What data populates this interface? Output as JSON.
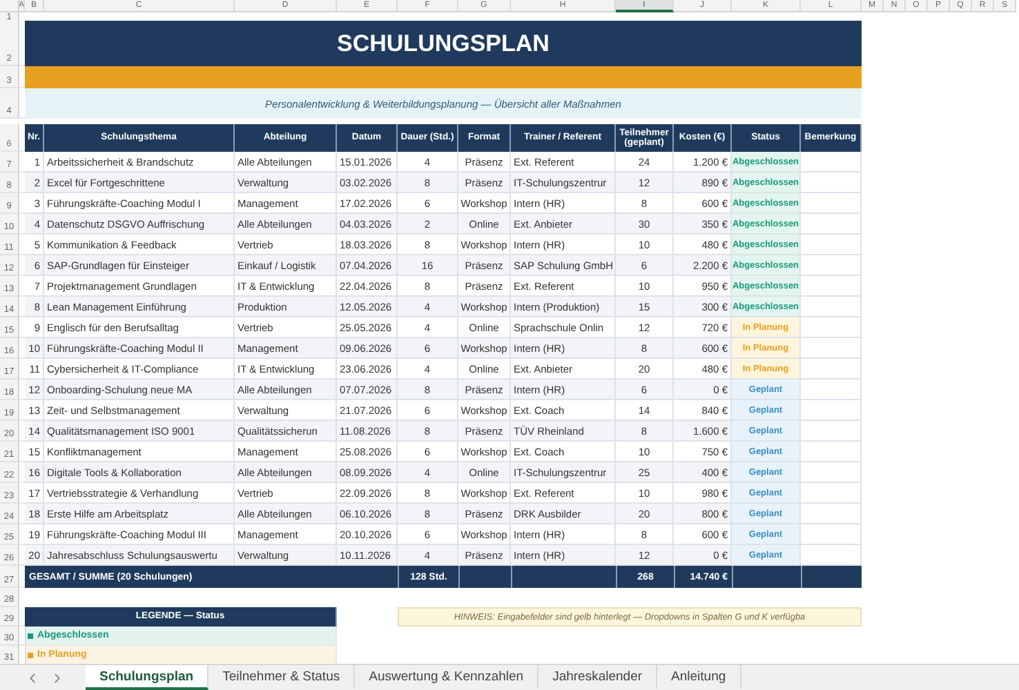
{
  "column_headers": [
    {
      "label": "A",
      "selected": false
    },
    {
      "label": "B",
      "selected": false
    },
    {
      "label": "C",
      "selected": false
    },
    {
      "label": "D",
      "selected": false
    },
    {
      "label": "E",
      "selected": false
    },
    {
      "label": "F",
      "selected": false
    },
    {
      "label": "G",
      "selected": false
    },
    {
      "label": "H",
      "selected": false
    },
    {
      "label": "I",
      "selected": true
    },
    {
      "label": "J",
      "selected": false
    },
    {
      "label": "K",
      "selected": false
    },
    {
      "label": "L",
      "selected": false
    },
    {
      "label": "M",
      "selected": false
    },
    {
      "label": "N",
      "selected": false
    },
    {
      "label": "O",
      "selected": false
    },
    {
      "label": "P",
      "selected": false
    },
    {
      "label": "Q",
      "selected": false
    },
    {
      "label": "R",
      "selected": false
    },
    {
      "label": "S",
      "selected": false
    }
  ],
  "row_headers": [
    "1",
    "2",
    "3",
    "4",
    "6",
    "7",
    "8",
    "9",
    "10",
    "11",
    "12",
    "13",
    "14",
    "15",
    "16",
    "17",
    "18",
    "19",
    "20",
    "21",
    "22",
    "23",
    "24",
    "25",
    "26",
    "27",
    "28",
    "29",
    "30",
    "31"
  ],
  "title": "SCHULUNGSPLAN",
  "subtitle": "Personalentwicklung & Weiterbildungsplanung — Übersicht aller Maßnahmen",
  "table": {
    "columns": [
      "Nr.",
      "Schulungsthema",
      "Abteilung",
      "Datum",
      "Dauer (Std.)",
      "Format",
      "Trainer / Referent",
      "Teilnehmer (geplant)",
      "Kosten (€)",
      "Status",
      "Bemerkung"
    ],
    "rows": [
      {
        "nr": "1",
        "topic": "Arbeitssicherheit & Brandschutz",
        "department": "Alle Abteilungen",
        "date": "15.01.2026",
        "duration": "4",
        "format": "Präsenz",
        "trainer": "Ext. Referent",
        "participants": "24",
        "costs": "1.200 €",
        "status": "Abgeschlossen",
        "kind": "done"
      },
      {
        "nr": "2",
        "topic": "Excel für Fortgeschrittene",
        "department": "Verwaltung",
        "date": "03.02.2026",
        "duration": "8",
        "format": "Präsenz",
        "trainer": "IT-Schulungszentrur",
        "participants": "12",
        "costs": "890 €",
        "status": "Abgeschlossen",
        "kind": "done"
      },
      {
        "nr": "3",
        "topic": "Führungskräfte-Coaching Modul I",
        "department": "Management",
        "date": "17.02.2026",
        "duration": "6",
        "format": "Workshop",
        "trainer": "Intern (HR)",
        "participants": "8",
        "costs": "600 €",
        "status": "Abgeschlossen",
        "kind": "done"
      },
      {
        "nr": "4",
        "topic": "Datenschutz DSGVO Auffrischung",
        "department": "Alle Abteilungen",
        "date": "04.03.2026",
        "duration": "2",
        "format": "Online",
        "trainer": "Ext. Anbieter",
        "participants": "30",
        "costs": "350 €",
        "status": "Abgeschlossen",
        "kind": "done"
      },
      {
        "nr": "5",
        "topic": "Kommunikation & Feedback",
        "department": "Vertrieb",
        "date": "18.03.2026",
        "duration": "8",
        "format": "Workshop",
        "trainer": "Intern (HR)",
        "participants": "10",
        "costs": "480 €",
        "status": "Abgeschlossen",
        "kind": "done"
      },
      {
        "nr": "6",
        "topic": "SAP-Grundlagen für Einsteiger",
        "department": "Einkauf / Logistik",
        "date": "07.04.2026",
        "duration": "16",
        "format": "Präsenz",
        "trainer": "SAP Schulung GmbH",
        "participants": "6",
        "costs": "2.200 €",
        "status": "Abgeschlossen",
        "kind": "done"
      },
      {
        "nr": "7",
        "topic": "Projektmanagement Grundlagen",
        "department": "IT & Entwicklung",
        "date": "22.04.2026",
        "duration": "8",
        "format": "Präsenz",
        "trainer": "Ext. Referent",
        "participants": "10",
        "costs": "950 €",
        "status": "Abgeschlossen",
        "kind": "done"
      },
      {
        "nr": "8",
        "topic": "Lean Management Einführung",
        "department": "Produktion",
        "date": "12.05.2026",
        "duration": "4",
        "format": "Workshop",
        "trainer": "Intern (Produktion)",
        "participants": "15",
        "costs": "300 €",
        "status": "Abgeschlossen",
        "kind": "done"
      },
      {
        "nr": "9",
        "topic": "Englisch für den Berufsalltag",
        "department": "Vertrieb",
        "date": "25.05.2026",
        "duration": "4",
        "format": "Online",
        "trainer": "Sprachschule Onlin",
        "participants": "12",
        "costs": "720 €",
        "status": "In Planung",
        "kind": "planning"
      },
      {
        "nr": "10",
        "topic": "Führungskräfte-Coaching Modul II",
        "department": "Management",
        "date": "09.06.2026",
        "duration": "6",
        "format": "Workshop",
        "trainer": "Intern (HR)",
        "participants": "8",
        "costs": "600 €",
        "status": "In Planung",
        "kind": "planning"
      },
      {
        "nr": "11",
        "topic": "Cybersicherheit & IT-Compliance",
        "department": "IT & Entwicklung",
        "date": "23.06.2026",
        "duration": "4",
        "format": "Online",
        "trainer": "Ext. Anbieter",
        "participants": "20",
        "costs": "480 €",
        "status": "In Planung",
        "kind": "planning"
      },
      {
        "nr": "12",
        "topic": "Onboarding-Schulung neue MA",
        "department": "Alle Abteilungen",
        "date": "07.07.2026",
        "duration": "8",
        "format": "Präsenz",
        "trainer": "Intern (HR)",
        "participants": "6",
        "costs": "0 €",
        "status": "Geplant",
        "kind": "planned"
      },
      {
        "nr": "13",
        "topic": "Zeit- und Selbstmanagement",
        "department": "Verwaltung",
        "date": "21.07.2026",
        "duration": "6",
        "format": "Workshop",
        "trainer": "Ext. Coach",
        "participants": "14",
        "costs": "840 €",
        "status": "Geplant",
        "kind": "planned"
      },
      {
        "nr": "14",
        "topic": "Qualitätsmanagement ISO 9001",
        "department": "Qualitätssicherun",
        "date": "11.08.2026",
        "duration": "8",
        "format": "Präsenz",
        "trainer": "TÜV Rheinland",
        "participants": "8",
        "costs": "1.600 €",
        "status": "Geplant",
        "kind": "planned"
      },
      {
        "nr": "15",
        "topic": "Konfliktmanagement",
        "department": "Management",
        "date": "25.08.2026",
        "duration": "6",
        "format": "Workshop",
        "trainer": "Ext. Coach",
        "participants": "10",
        "costs": "750 €",
        "status": "Geplant",
        "kind": "planned"
      },
      {
        "nr": "16",
        "topic": "Digitale Tools & Kollaboration",
        "department": "Alle Abteilungen",
        "date": "08.09.2026",
        "duration": "4",
        "format": "Online",
        "trainer": "IT-Schulungszentrur",
        "participants": "25",
        "costs": "400 €",
        "status": "Geplant",
        "kind": "planned"
      },
      {
        "nr": "17",
        "topic": "Vertriebsstrategie & Verhandlung",
        "department": "Vertrieb",
        "date": "22.09.2026",
        "duration": "8",
        "format": "Workshop",
        "trainer": "Ext. Referent",
        "participants": "10",
        "costs": "980 €",
        "status": "Geplant",
        "kind": "planned"
      },
      {
        "nr": "18",
        "topic": "Erste Hilfe am Arbeitsplatz",
        "department": "Alle Abteilungen",
        "date": "06.10.2026",
        "duration": "8",
        "format": "Präsenz",
        "trainer": "DRK Ausbilder",
        "participants": "20",
        "costs": "800 €",
        "status": "Geplant",
        "kind": "planned"
      },
      {
        "nr": "19",
        "topic": "Führungskräfte-Coaching Modul III",
        "department": "Management",
        "date": "20.10.2026",
        "duration": "6",
        "format": "Workshop",
        "trainer": "Intern (HR)",
        "participants": "8",
        "costs": "600 €",
        "status": "Geplant",
        "kind": "planned"
      },
      {
        "nr": "20",
        "topic": "Jahresabschluss Schulungsauswertu",
        "department": "Verwaltung",
        "date": "10.11.2026",
        "duration": "4",
        "format": "Präsenz",
        "trainer": "Intern (HR)",
        "participants": "12",
        "costs": "0 €",
        "status": "Geplant",
        "kind": "planned"
      }
    ],
    "totals": {
      "label": "GESAMT / SUMME (20 Schulungen)",
      "duration": "128 Std.",
      "participants": "268",
      "costs": "14.740 €"
    }
  },
  "legend": {
    "title": "LEGENDE — Status",
    "items": [
      {
        "label": "Abgeschlossen",
        "color": "#1a9a7a"
      },
      {
        "label": "In Planung",
        "color": "#e8a020"
      }
    ]
  },
  "hint": "HINWEIS: Eingabefelder sind gelb hinterlegt — Dropdowns in Spalten G und K verfügba",
  "sheet_tabs": [
    {
      "label": "Schulungsplan",
      "selected": true
    },
    {
      "label": "Teilnehmer & Status",
      "selected": false
    },
    {
      "label": "Auswertung & Kennzahlen",
      "selected": false
    },
    {
      "label": "Jahreskalender",
      "selected": false
    },
    {
      "label": "Anleitung",
      "selected": false
    }
  ]
}
